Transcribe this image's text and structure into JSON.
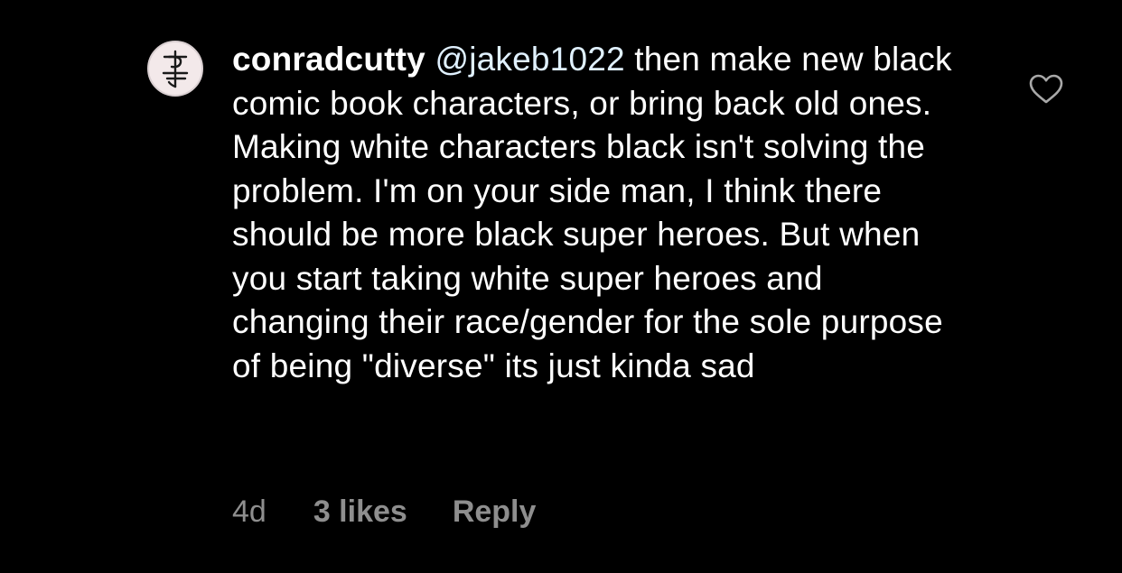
{
  "comment": {
    "username": "conradcutty",
    "mention": "@jakeb1022",
    "text": " then make new black comic book characters, or bring back old ones. Making white characters black isn't solving the problem. I'm on your side man, I think there should be more black super heroes. But when you start taking white super heroes and changing their race/gender for the sole purpose of being \"diverse\" its just kinda sad",
    "timestamp": "4d",
    "likes_label": "3 likes",
    "reply_label": "Reply"
  },
  "icons": {
    "avatar": "profile-avatar",
    "like": "heart-outline-icon"
  },
  "colors": {
    "background": "#000000",
    "text": "#ffffff",
    "meta": "#8e8e8e",
    "mention": "#e0f1ff"
  }
}
